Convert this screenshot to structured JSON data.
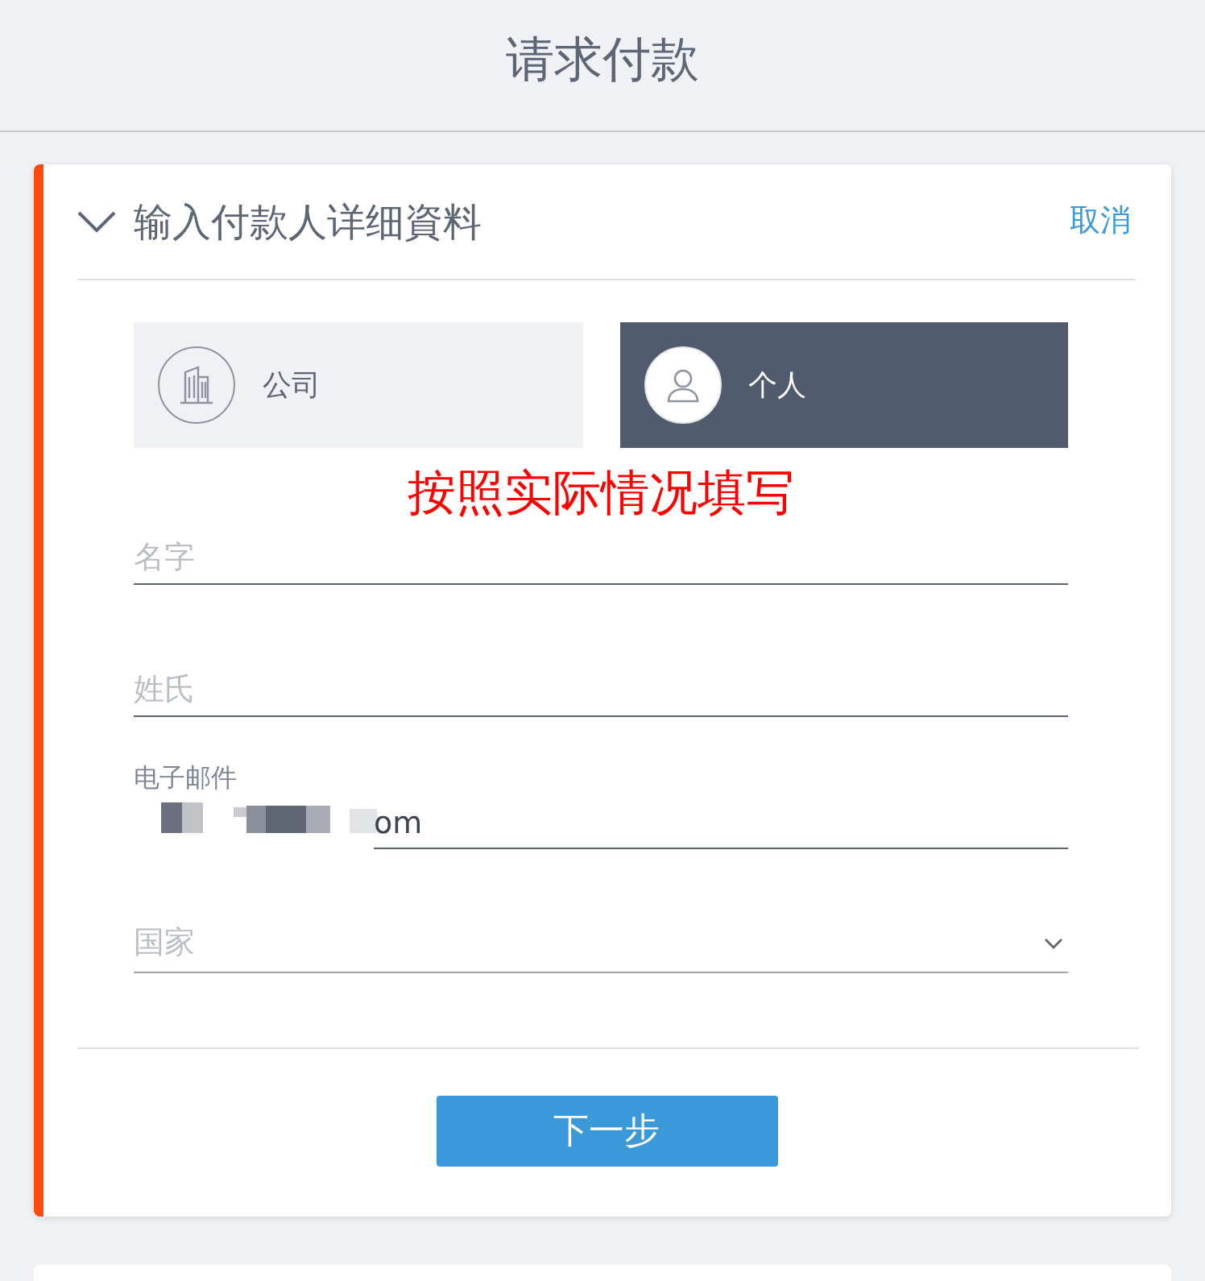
{
  "header": {
    "title": "请求付款"
  },
  "section": {
    "title": "输入付款人详细資料",
    "expanded": true,
    "cancel": "取消"
  },
  "payer_types": [
    {
      "kind": "company",
      "label": "公司",
      "selected": false
    },
    {
      "kind": "person",
      "label": "个人",
      "selected": true
    }
  ],
  "annotation": "按照实际情况填写",
  "fields": [
    {
      "kind": "text",
      "placeholder": "名字"
    },
    {
      "kind": "text",
      "placeholder": "姓氏"
    },
    {
      "kind": "email",
      "label": "电子邮件",
      "value": "om"
    },
    {
      "kind": "select",
      "placeholder": "国家"
    }
  ],
  "next_button": "下一步"
}
